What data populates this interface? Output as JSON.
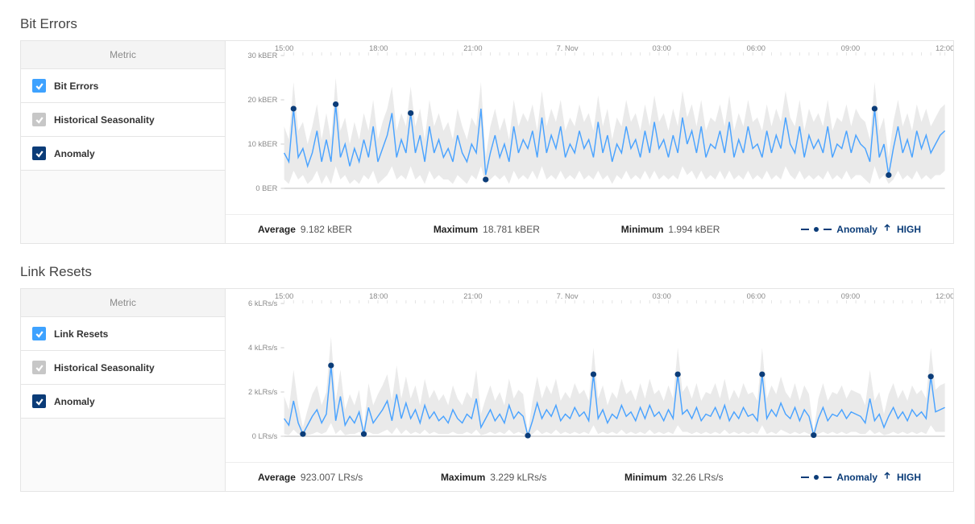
{
  "panels": [
    {
      "id": "bit-errors",
      "title": "Bit Errors",
      "legend_header": "Metric",
      "metrics": [
        {
          "label": "Bit Errors",
          "style": "blue"
        },
        {
          "label": "Historical Seasonality",
          "style": "grey"
        },
        {
          "label": "Anomaly",
          "style": "dark"
        }
      ],
      "stats": {
        "average_label": "Average",
        "average_value": "9.182 kBER",
        "maximum_label": "Maximum",
        "maximum_value": "18.781 kBER",
        "minimum_label": "Minimum",
        "minimum_value": "1.994 kBER",
        "anomaly_label": "Anomaly",
        "anomaly_level": "HIGH"
      }
    },
    {
      "id": "link-resets",
      "title": "Link Resets",
      "legend_header": "Metric",
      "metrics": [
        {
          "label": "Link Resets",
          "style": "blue"
        },
        {
          "label": "Historical Seasonality",
          "style": "grey"
        },
        {
          "label": "Anomaly",
          "style": "dark"
        }
      ],
      "stats": {
        "average_label": "Average",
        "average_value": "923.007 LRs/s",
        "maximum_label": "Maximum",
        "maximum_value": "3.229 kLRs/s",
        "minimum_label": "Minimum",
        "minimum_value": "32.26 LRs/s",
        "anomaly_label": "Anomaly",
        "anomaly_level": "HIGH"
      }
    }
  ],
  "chart_data": [
    {
      "type": "line",
      "title": "Bit Errors",
      "xlabel": "",
      "ylabel": "",
      "x_categories": [
        "15:00",
        "18:00",
        "21:00",
        "7. Nov",
        "03:00",
        "06:00",
        "09:00",
        "12:00"
      ],
      "y_ticks": [
        {
          "v": 0,
          "label": "0 BER"
        },
        {
          "v": 10,
          "label": "10 kBER"
        },
        {
          "v": 20,
          "label": "20 kBER"
        },
        {
          "v": 30,
          "label": "30 kBER"
        }
      ],
      "ylim": [
        0,
        30
      ],
      "series": [
        {
          "name": "Bit Errors",
          "color": "#4aa3ff",
          "values": [
            8,
            6,
            18,
            7,
            9,
            5,
            8,
            13,
            6,
            11,
            6,
            19,
            7,
            10,
            5,
            9,
            6,
            11,
            7,
            14,
            6,
            9,
            12,
            17,
            7,
            11,
            8,
            17,
            8,
            12,
            6,
            14,
            8,
            11,
            7,
            9,
            6,
            12,
            8,
            6,
            10,
            8,
            18,
            3,
            8,
            12,
            7,
            10,
            6,
            14,
            8,
            11,
            9,
            13,
            7,
            16,
            8,
            12,
            9,
            14,
            7,
            10,
            8,
            13,
            9,
            11,
            7,
            15,
            8,
            12,
            6,
            10,
            8,
            14,
            9,
            11,
            7,
            13,
            8,
            15,
            9,
            11,
            7,
            12,
            8,
            16,
            10,
            13,
            8,
            14,
            7,
            10,
            9,
            13,
            8,
            15,
            7,
            11,
            8,
            14,
            9,
            10,
            7,
            13,
            8,
            12,
            9,
            16,
            10,
            8,
            14,
            7,
            12,
            9,
            11,
            8,
            14,
            7,
            10,
            9,
            13,
            8,
            12,
            10,
            9,
            6,
            18,
            7,
            10,
            3,
            9,
            14,
            8,
            11,
            7,
            13,
            9,
            12,
            8,
            10,
            12,
            13
          ]
        },
        {
          "name": "Historical Seasonality",
          "band": true,
          "lower": [
            2,
            1,
            4,
            2,
            3,
            1,
            2,
            4,
            1,
            3,
            1,
            5,
            2,
            3,
            1,
            2,
            1,
            3,
            2,
            4,
            1,
            2,
            3,
            5,
            2,
            3,
            2,
            5,
            2,
            3,
            1,
            4,
            2,
            3,
            2,
            2,
            1,
            3,
            2,
            1,
            3,
            2,
            5,
            1,
            2,
            3,
            2,
            3,
            1,
            4,
            2,
            3,
            2,
            4,
            2,
            5,
            2,
            3,
            2,
            4,
            2,
            3,
            2,
            4,
            2,
            3,
            2,
            4,
            2,
            3,
            1,
            3,
            2,
            4,
            2,
            3,
            2,
            4,
            2,
            4,
            2,
            3,
            2,
            3,
            2,
            5,
            3,
            4,
            2,
            4,
            2,
            3,
            2,
            4,
            2,
            4,
            2,
            3,
            2,
            4,
            2,
            3,
            2,
            4,
            2,
            3,
            2,
            5,
            3,
            2,
            4,
            2,
            3,
            2,
            3,
            2,
            4,
            2,
            3,
            2,
            4,
            2,
            3,
            3,
            2,
            1,
            5,
            2,
            3,
            1,
            2,
            4,
            2,
            3,
            2,
            4,
            2,
            3,
            2,
            3,
            3,
            4
          ],
          "upper": [
            14,
            11,
            24,
            13,
            15,
            10,
            14,
            19,
            11,
            17,
            11,
            25,
            13,
            16,
            10,
            15,
            11,
            17,
            13,
            20,
            11,
            15,
            18,
            23,
            13,
            17,
            14,
            23,
            14,
            18,
            11,
            20,
            14,
            17,
            13,
            15,
            11,
            18,
            14,
            11,
            16,
            14,
            24,
            7,
            14,
            18,
            13,
            16,
            11,
            20,
            14,
            17,
            15,
            19,
            13,
            22,
            14,
            18,
            15,
            20,
            13,
            16,
            14,
            19,
            15,
            17,
            13,
            21,
            14,
            18,
            11,
            16,
            14,
            20,
            15,
            17,
            13,
            19,
            14,
            21,
            15,
            17,
            13,
            18,
            14,
            22,
            16,
            19,
            14,
            20,
            13,
            16,
            15,
            19,
            14,
            21,
            13,
            17,
            14,
            20,
            15,
            16,
            13,
            19,
            14,
            18,
            15,
            22,
            16,
            14,
            20,
            13,
            18,
            15,
            17,
            14,
            20,
            13,
            16,
            15,
            19,
            14,
            18,
            16,
            15,
            11,
            24,
            13,
            16,
            7,
            15,
            20,
            14,
            17,
            13,
            19,
            15,
            18,
            14,
            16,
            18,
            19
          ]
        }
      ],
      "anomalies": [
        {
          "i": 2,
          "v": 18
        },
        {
          "i": 11,
          "v": 19
        },
        {
          "i": 27,
          "v": 17
        },
        {
          "i": 43,
          "v": 2
        },
        {
          "i": 126,
          "v": 18
        },
        {
          "i": 129,
          "v": 3
        }
      ]
    },
    {
      "type": "line",
      "title": "Link Resets",
      "xlabel": "",
      "ylabel": "",
      "x_categories": [
        "15:00",
        "18:00",
        "21:00",
        "7. Nov",
        "03:00",
        "06:00",
        "09:00",
        "12:00"
      ],
      "y_ticks": [
        {
          "v": 0,
          "label": "0 LRs/s"
        },
        {
          "v": 2,
          "label": "2 kLRs/s"
        },
        {
          "v": 4,
          "label": "4 kLRs/s"
        },
        {
          "v": 6,
          "label": "6 kLRs/s"
        }
      ],
      "ylim": [
        0,
        6
      ],
      "series": [
        {
          "name": "Link Resets",
          "color": "#4aa3ff",
          "values": [
            0.8,
            0.5,
            1.6,
            0.6,
            0.1,
            0.5,
            0.9,
            1.2,
            0.6,
            1.0,
            3.2,
            0.7,
            1.8,
            0.5,
            0.9,
            0.6,
            1.1,
            0.1,
            1.3,
            0.6,
            0.9,
            1.2,
            1.6,
            0.7,
            1.9,
            0.8,
            1.5,
            0.8,
            1.2,
            0.6,
            1.4,
            0.8,
            1.1,
            0.7,
            0.9,
            0.6,
            1.2,
            0.8,
            0.6,
            1.0,
            0.8,
            1.7,
            0.4,
            0.8,
            1.2,
            0.7,
            1.0,
            0.6,
            1.4,
            0.8,
            1.1,
            0.9,
            0.03,
            0.7,
            1.5,
            0.8,
            1.2,
            0.9,
            1.4,
            0.7,
            1.0,
            0.8,
            1.3,
            0.9,
            1.1,
            0.7,
            2.8,
            0.8,
            1.2,
            0.6,
            1.0,
            0.8,
            1.4,
            0.9,
            1.1,
            0.7,
            1.3,
            0.8,
            1.4,
            0.9,
            1.1,
            0.7,
            1.2,
            0.8,
            2.8,
            1.0,
            1.2,
            0.8,
            1.3,
            0.7,
            1.0,
            0.9,
            1.3,
            0.8,
            1.4,
            0.7,
            1.1,
            0.8,
            1.3,
            0.9,
            1.0,
            0.7,
            2.8,
            0.8,
            1.2,
            0.9,
            1.5,
            1.0,
            0.8,
            1.3,
            0.7,
            1.2,
            0.9,
            0.05,
            0.8,
            1.3,
            0.7,
            1.0,
            0.9,
            1.2,
            0.8,
            1.1,
            1.0,
            0.9,
            0.6,
            1.7,
            0.7,
            1.0,
            0.4,
            0.9,
            1.3,
            0.8,
            1.1,
            0.7,
            1.2,
            0.9,
            1.1,
            0.8,
            2.7,
            1.1,
            1.2,
            1.3
          ]
        },
        {
          "name": "Historical Seasonality",
          "band": true,
          "lower": [
            0.1,
            0.05,
            0.3,
            0.1,
            0.02,
            0.05,
            0.1,
            0.2,
            0.1,
            0.2,
            0.6,
            0.1,
            0.3,
            0.05,
            0.1,
            0.1,
            0.2,
            0.02,
            0.2,
            0.1,
            0.1,
            0.2,
            0.3,
            0.1,
            0.4,
            0.1,
            0.3,
            0.1,
            0.2,
            0.1,
            0.3,
            0.1,
            0.2,
            0.1,
            0.1,
            0.1,
            0.2,
            0.1,
            0.1,
            0.2,
            0.1,
            0.3,
            0.05,
            0.1,
            0.2,
            0.1,
            0.2,
            0.1,
            0.3,
            0.1,
            0.2,
            0.1,
            0.005,
            0.1,
            0.3,
            0.1,
            0.2,
            0.1,
            0.3,
            0.1,
            0.2,
            0.1,
            0.2,
            0.1,
            0.2,
            0.1,
            0.5,
            0.1,
            0.2,
            0.1,
            0.2,
            0.1,
            0.3,
            0.1,
            0.2,
            0.1,
            0.2,
            0.1,
            0.3,
            0.1,
            0.2,
            0.1,
            0.2,
            0.1,
            0.5,
            0.2,
            0.2,
            0.1,
            0.2,
            0.1,
            0.2,
            0.1,
            0.2,
            0.1,
            0.3,
            0.1,
            0.2,
            0.1,
            0.2,
            0.1,
            0.2,
            0.1,
            0.5,
            0.1,
            0.2,
            0.1,
            0.3,
            0.2,
            0.1,
            0.2,
            0.1,
            0.2,
            0.1,
            0.01,
            0.1,
            0.2,
            0.1,
            0.2,
            0.1,
            0.2,
            0.1,
            0.2,
            0.2,
            0.1,
            0.1,
            0.3,
            0.1,
            0.2,
            0.05,
            0.1,
            0.2,
            0.1,
            0.2,
            0.1,
            0.2,
            0.1,
            0.2,
            0.1,
            0.5,
            0.2,
            0.2,
            0.2
          ],
          "upper": [
            1.8,
            1.2,
            3.0,
            1.4,
            0.4,
            1.2,
            1.9,
            2.3,
            1.4,
            2.0,
            4.5,
            1.6,
            3.0,
            1.2,
            1.9,
            1.4,
            2.1,
            0.4,
            2.4,
            1.4,
            1.9,
            2.3,
            2.8,
            1.6,
            3.2,
            1.7,
            2.7,
            1.7,
            2.3,
            1.4,
            2.6,
            1.7,
            2.1,
            1.6,
            1.9,
            1.4,
            2.3,
            1.7,
            1.4,
            2.0,
            1.7,
            3.0,
            1.0,
            1.7,
            2.3,
            1.6,
            2.0,
            1.4,
            2.6,
            1.7,
            2.1,
            1.9,
            0.15,
            1.6,
            2.7,
            1.7,
            2.3,
            1.9,
            2.6,
            1.6,
            2.0,
            1.7,
            2.4,
            1.9,
            2.1,
            1.6,
            4.0,
            1.7,
            2.3,
            1.4,
            2.0,
            1.7,
            2.6,
            1.9,
            2.1,
            1.6,
            2.4,
            1.7,
            2.6,
            1.9,
            2.1,
            1.6,
            2.3,
            1.7,
            4.0,
            2.0,
            2.3,
            1.7,
            2.4,
            1.6,
            2.0,
            1.9,
            2.4,
            1.7,
            2.6,
            1.6,
            2.1,
            1.7,
            2.4,
            1.9,
            2.0,
            1.6,
            4.0,
            1.7,
            2.3,
            1.9,
            2.7,
            2.0,
            1.7,
            2.4,
            1.6,
            2.3,
            1.9,
            0.2,
            1.7,
            2.4,
            1.6,
            2.0,
            1.9,
            2.3,
            1.7,
            2.1,
            2.0,
            1.9,
            1.4,
            3.0,
            1.6,
            2.0,
            1.0,
            1.9,
            2.4,
            1.7,
            2.1,
            1.6,
            2.3,
            1.9,
            2.1,
            1.7,
            4.0,
            2.1,
            2.3,
            2.4
          ]
        }
      ],
      "anomalies": [
        {
          "i": 4,
          "v": 0.1
        },
        {
          "i": 10,
          "v": 3.2
        },
        {
          "i": 17,
          "v": 0.1
        },
        {
          "i": 52,
          "v": 0.03
        },
        {
          "i": 66,
          "v": 2.8
        },
        {
          "i": 84,
          "v": 2.8
        },
        {
          "i": 102,
          "v": 2.8
        },
        {
          "i": 113,
          "v": 0.05
        },
        {
          "i": 138,
          "v": 2.7
        }
      ]
    }
  ]
}
